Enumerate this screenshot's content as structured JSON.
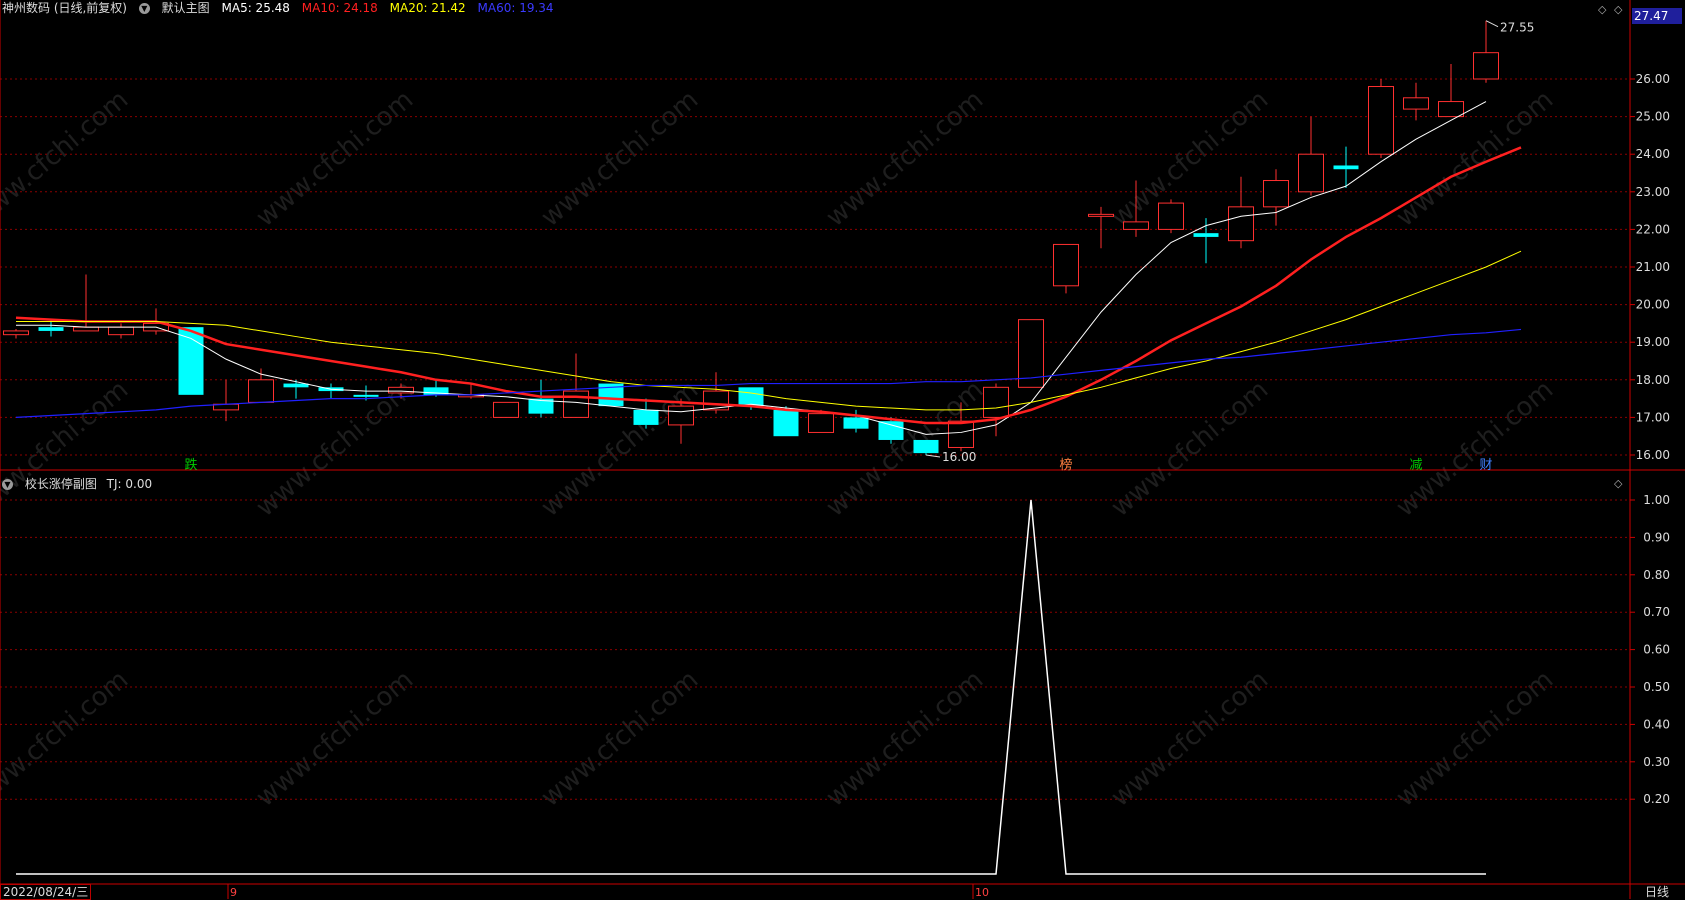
{
  "header": {
    "stock_name": "神州数码 (日线,前复权)",
    "main_chart_label": "默认主图",
    "ma": [
      {
        "label": "MA5: 25.48",
        "color": "#ffffff"
      },
      {
        "label": "MA10: 24.18",
        "color": "#ff2020"
      },
      {
        "label": "MA20: 21.42",
        "color": "#ffff00"
      },
      {
        "label": "MA60: 19.34",
        "color": "#2020ff"
      }
    ],
    "last_price": "27.47"
  },
  "sub_chart": {
    "title": "校长涨停副图",
    "value_label": "TJ: 0.00"
  },
  "footer": {
    "date": "2022/08/24/三",
    "period": "日线",
    "month_labels": [
      "9",
      "10"
    ]
  },
  "annotations": {
    "high_label": "27.55",
    "low_label": "16.00",
    "markers": [
      {
        "text": "跌",
        "color": "#00cc00"
      },
      {
        "text": "榜",
        "color": "#ff8040"
      },
      {
        "text": "减",
        "color": "#00cc00"
      },
      {
        "text": "财",
        "color": "#4080ff"
      }
    ]
  },
  "watermark": "www.cfchi.com",
  "colors": {
    "up": "#ff3030",
    "down": "#00ffff",
    "grid": "#8b0000",
    "axis": "#cc0000"
  },
  "chart_data": [
    {
      "type": "candlestick",
      "y_ticks": [
        16.0,
        17.0,
        18.0,
        19.0,
        20.0,
        21.0,
        22.0,
        23.0,
        24.0,
        25.0,
        26.0
      ],
      "y_tick_labels": [
        "16.00",
        "17.00",
        "18.00",
        "19.00",
        "20.00",
        "21.00",
        "22.00",
        "23.00",
        "24.00",
        "25.00",
        "26.00"
      ],
      "ylim": [
        15.6,
        27.8
      ],
      "candles": [
        [
          19.2,
          19.3,
          19.1,
          19.35
        ],
        [
          19.4,
          19.3,
          19.15,
          19.6
        ],
        [
          19.3,
          19.4,
          19.3,
          20.8
        ],
        [
          19.2,
          19.4,
          19.1,
          19.5
        ],
        [
          19.3,
          19.5,
          19.2,
          19.9
        ],
        [
          19.4,
          17.6,
          17.6,
          19.4
        ],
        [
          17.2,
          17.35,
          16.9,
          18.0
        ],
        [
          17.4,
          18.0,
          17.4,
          18.3
        ],
        [
          17.9,
          17.8,
          17.5,
          18.0
        ],
        [
          17.8,
          17.7,
          17.5,
          17.9
        ],
        [
          17.6,
          17.55,
          17.45,
          17.85
        ],
        [
          17.65,
          17.8,
          17.5,
          17.9
        ],
        [
          17.8,
          17.6,
          17.55,
          18.0
        ],
        [
          17.6,
          17.6,
          17.5,
          17.9
        ],
        [
          17.0,
          17.4,
          17.0,
          17.4
        ],
        [
          17.5,
          17.1,
          17.0,
          18.0
        ],
        [
          17.0,
          17.7,
          17.0,
          18.7
        ],
        [
          17.9,
          17.3,
          17.3,
          17.9
        ],
        [
          17.2,
          16.8,
          16.7,
          17.5
        ],
        [
          16.8,
          17.3,
          16.3,
          17.5
        ],
        [
          17.2,
          17.7,
          17.1,
          18.2
        ],
        [
          17.8,
          17.3,
          17.2,
          17.8
        ],
        [
          17.2,
          16.5,
          16.5,
          17.3
        ],
        [
          16.6,
          17.1,
          16.6,
          17.2
        ],
        [
          17.0,
          16.7,
          16.6,
          17.2
        ],
        [
          16.9,
          16.4,
          16.3,
          17.0
        ],
        [
          16.4,
          16.05,
          16.0,
          16.4
        ],
        [
          16.2,
          16.9,
          16.1,
          17.4
        ],
        [
          17.0,
          17.8,
          16.5,
          17.9
        ],
        [
          17.8,
          19.6,
          17.8,
          19.6
        ],
        [
          20.5,
          21.6,
          20.3,
          21.6
        ],
        [
          22.4,
          22.4,
          21.5,
          22.6
        ],
        [
          22.0,
          22.2,
          21.8,
          23.3
        ],
        [
          22.0,
          22.7,
          21.9,
          22.8
        ],
        [
          21.9,
          21.8,
          21.1,
          22.3
        ],
        [
          21.7,
          22.6,
          21.5,
          23.4
        ],
        [
          22.6,
          23.3,
          22.1,
          23.6
        ],
        [
          23.0,
          24.0,
          22.9,
          25.0
        ],
        [
          23.7,
          23.6,
          23.1,
          24.2
        ],
        [
          24.0,
          25.8,
          23.9,
          26.0
        ],
        [
          25.2,
          25.5,
          24.9,
          25.9
        ],
        [
          25.0,
          25.4,
          25.0,
          26.4
        ],
        [
          26.0,
          26.7,
          25.9,
          27.55
        ]
      ],
      "series": [
        {
          "name": "MA5",
          "values": [
            19.45,
            19.45,
            19.4,
            19.4,
            19.4,
            19.1,
            18.55,
            18.15,
            17.95,
            17.75,
            17.7,
            17.7,
            17.65,
            17.6,
            17.55,
            17.45,
            17.4,
            17.3,
            17.2,
            17.15,
            17.25,
            17.35,
            17.25,
            17.15,
            17.05,
            16.8,
            16.55,
            16.6,
            16.8,
            17.4,
            18.6,
            19.8,
            20.8,
            21.65,
            22.1,
            22.35,
            22.45,
            22.85,
            23.15,
            23.8,
            24.4,
            24.9,
            25.4
          ]
        },
        {
          "name": "MA10",
          "values": [
            19.65,
            19.6,
            19.55,
            19.55,
            19.55,
            19.3,
            18.95,
            18.8,
            18.65,
            18.5,
            18.35,
            18.2,
            18.0,
            17.9,
            17.7,
            17.55,
            17.55,
            17.5,
            17.45,
            17.4,
            17.35,
            17.3,
            17.2,
            17.15,
            17.05,
            16.95,
            16.85,
            16.85,
            16.95,
            17.2,
            17.55,
            18.0,
            18.5,
            19.05,
            19.5,
            19.95,
            20.5,
            21.2,
            21.8,
            22.3,
            22.85,
            23.4,
            23.8,
            24.18
          ]
        },
        {
          "name": "MA20",
          "values": [
            19.55,
            19.55,
            19.55,
            19.55,
            19.55,
            19.5,
            19.45,
            19.3,
            19.15,
            19.0,
            18.9,
            18.8,
            18.7,
            18.55,
            18.4,
            18.25,
            18.1,
            17.95,
            17.85,
            17.8,
            17.75,
            17.65,
            17.5,
            17.4,
            17.3,
            17.25,
            17.2,
            17.2,
            17.25,
            17.4,
            17.6,
            17.8,
            18.05,
            18.3,
            18.5,
            18.75,
            19.0,
            19.3,
            19.6,
            19.95,
            20.3,
            20.65,
            21.0,
            21.42
          ]
        },
        {
          "name": "MA60",
          "values": [
            17.0,
            17.05,
            17.1,
            17.15,
            17.2,
            17.3,
            17.35,
            17.4,
            17.45,
            17.5,
            17.5,
            17.55,
            17.6,
            17.6,
            17.65,
            17.7,
            17.75,
            17.8,
            17.85,
            17.85,
            17.85,
            17.9,
            17.9,
            17.9,
            17.9,
            17.9,
            17.95,
            17.95,
            18.0,
            18.05,
            18.15,
            18.25,
            18.35,
            18.45,
            18.55,
            18.6,
            18.7,
            18.8,
            18.9,
            19.0,
            19.1,
            19.2,
            19.25,
            19.34
          ]
        }
      ]
    },
    {
      "type": "line",
      "name": "TJ",
      "y_ticks": [
        0.2,
        0.3,
        0.4,
        0.5,
        0.6,
        0.7,
        0.8,
        0.9,
        1.0
      ],
      "y_tick_labels": [
        "0.20",
        "0.30",
        "0.40",
        "0.50",
        "0.60",
        "0.70",
        "0.80",
        "0.90",
        "1.00"
      ],
      "ylim": [
        0.0,
        1.0
      ],
      "values": [
        0,
        0,
        0,
        0,
        0,
        0,
        0,
        0,
        0,
        0,
        0,
        0,
        0,
        0,
        0,
        0,
        0,
        0,
        0,
        0,
        0,
        0,
        0,
        0,
        0,
        0,
        0,
        0,
        0,
        1,
        0,
        0,
        0,
        0,
        0,
        0,
        0,
        0,
        0,
        0,
        0,
        0,
        0
      ]
    }
  ]
}
